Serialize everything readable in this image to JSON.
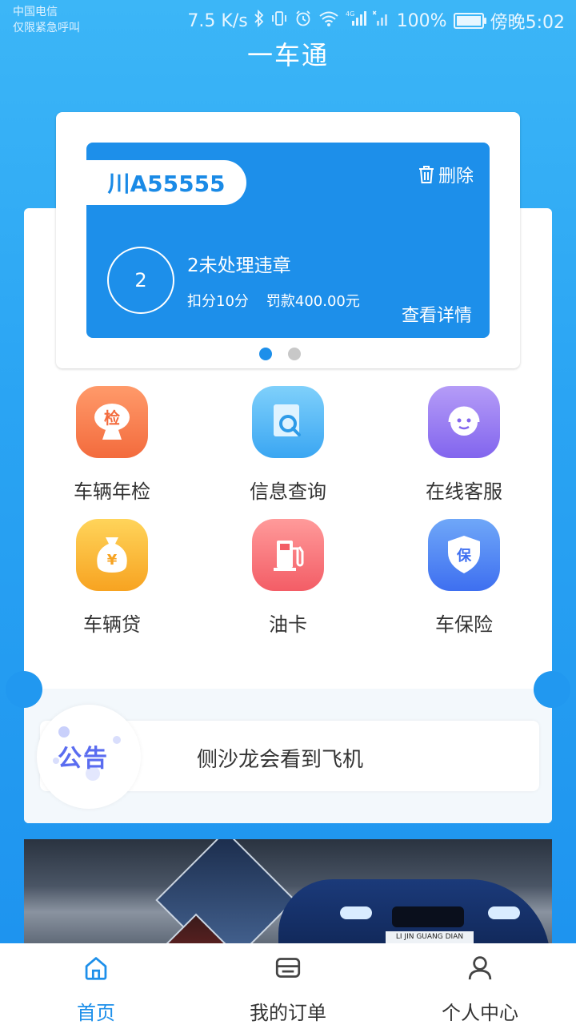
{
  "status_bar": {
    "carrier_line1": "中国电信",
    "carrier_line2": "仅限紧急呼叫",
    "speed": "7.5 K/s",
    "network": "4G",
    "battery": "100%",
    "time": "傍晚5:02"
  },
  "header": {
    "title": "一车通"
  },
  "violation_card": {
    "plate": "川A55555",
    "delete_label": "删除",
    "count": "2",
    "title": "2未处理违章",
    "points": "扣分10分",
    "fine": "罚款400.00元",
    "detail_label": "查看详情"
  },
  "carousel": {
    "total": 2,
    "active_index": 0
  },
  "services": [
    {
      "label": "车辆年检",
      "icon": "inspection-icon",
      "glyph": "检"
    },
    {
      "label": "信息查询",
      "icon": "document-search-icon",
      "glyph": ""
    },
    {
      "label": "在线客服",
      "icon": "customer-service-icon",
      "glyph": ""
    },
    {
      "label": "车辆贷",
      "icon": "money-bag-icon",
      "glyph": "¥"
    },
    {
      "label": "油卡",
      "icon": "fuel-pump-icon",
      "glyph": ""
    },
    {
      "label": "车保险",
      "icon": "insurance-shield-icon",
      "glyph": "保"
    }
  ],
  "notice": {
    "badge": "公告",
    "text": "侧沙龙会看到飞机"
  },
  "banner": {
    "plate_text": "LI JIN GUANG DIAN"
  },
  "bottom_nav": [
    {
      "label": "首页",
      "icon": "home-icon",
      "active": true
    },
    {
      "label": "我的订单",
      "icon": "orders-icon",
      "active": false
    },
    {
      "label": "个人中心",
      "icon": "profile-icon",
      "active": false
    }
  ],
  "colors": {
    "primary": "#1d8fea",
    "background_top": "#3cb6f7",
    "text": "#333333"
  }
}
